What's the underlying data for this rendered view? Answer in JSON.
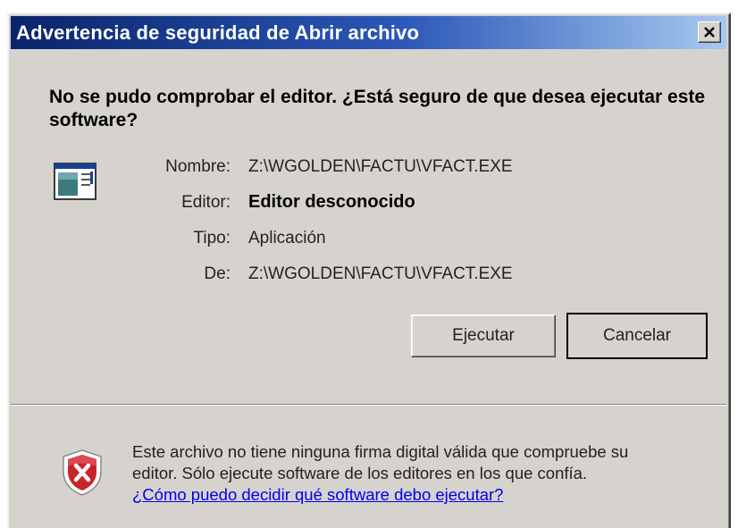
{
  "window": {
    "title": "Advertencia de seguridad de Abrir archivo",
    "close_glyph": "✕"
  },
  "question": "No se pudo comprobar el editor. ¿Está seguro de que desea ejecutar este software?",
  "details": {
    "name_label": "Nombre:",
    "name_value": "Z:\\WGOLDEN\\FACTU\\VFACT.EXE",
    "editor_label": "Editor:",
    "editor_value": "Editor desconocido",
    "type_label": "Tipo:",
    "type_value": "Aplicación",
    "from_label": "De:",
    "from_value": "Z:\\WGOLDEN\\FACTU\\VFACT.EXE"
  },
  "buttons": {
    "run": "Ejecutar",
    "cancel": "Cancelar"
  },
  "warning": {
    "line1": "Este archivo no tiene ninguna firma digital válida que compruebe su",
    "line2": "editor. Sólo ejecute software de los editores en los que confía.",
    "link": "¿Cómo puedo decidir qué software debo ejecutar?"
  },
  "icons": {
    "file": "application-file-icon",
    "warning": "shield-x-icon"
  },
  "colors": {
    "title_start": "#0a246a",
    "title_end": "#a6caf0",
    "window_bg": "#d6d3ce",
    "link": "#0000ee",
    "shield_red": "#c8242a"
  }
}
